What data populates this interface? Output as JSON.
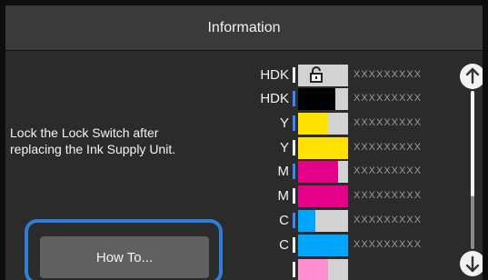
{
  "header": {
    "title": "Information"
  },
  "message": {
    "line1": "Lock the Lock Switch after",
    "line2": "replacing the Ink Supply Unit."
  },
  "buttons": {
    "how_to": "How To..."
  },
  "ink": [
    {
      "code": "HDK",
      "tick_color": "#efefef",
      "fill": 0,
      "fill_color": "#000000",
      "state": "unlocked",
      "mask": "XXXXXXXXX",
      "icon": "unlock-icon"
    },
    {
      "code": "HDK",
      "tick_color": "#3b86ff",
      "fill": 0.75,
      "fill_color": "#000000",
      "mask": "XXXXXXXXX"
    },
    {
      "code": "Y",
      "tick_color": "#3b86ff",
      "fill": 0.6,
      "fill_color": "#ffe100",
      "mask": "XXXXXXXXX"
    },
    {
      "code": "Y",
      "tick_color": "#efefef",
      "fill": 1,
      "fill_color": "#ffe100",
      "mask": "XXXXXXXXX"
    },
    {
      "code": "M",
      "tick_color": "#3b86ff",
      "fill": 0.8,
      "fill_color": "#e5008a",
      "mask": "XXXXXXXXX"
    },
    {
      "code": "M",
      "tick_color": "#efefef",
      "fill": 1,
      "fill_color": "#e5008a",
      "mask": "XXXXXXXXX"
    },
    {
      "code": "C",
      "tick_color": "#3b86ff",
      "fill": 0.35,
      "fill_color": "#00a6ff",
      "mask": "XXXXXXXXX"
    },
    {
      "code": "C",
      "tick_color": "#efefef",
      "fill": 1,
      "fill_color": "#00a6ff",
      "mask": "XXXXXXXXX"
    },
    {
      "code": "",
      "tick_color": "#efefef",
      "fill": 0.6,
      "fill_color": "#ff8fcf",
      "mask": ""
    }
  ],
  "scroll": {
    "up_icon": "arrow-up-icon",
    "down_icon": "arrow-down-icon"
  },
  "colors": {
    "accent": "#2f7ed8",
    "tick_blue": "#3b86ff",
    "black": "#000000",
    "yellow": "#ffe100",
    "magenta": "#e5008a",
    "cyan": "#00a6ff",
    "light_magenta": "#ff8fcf"
  }
}
